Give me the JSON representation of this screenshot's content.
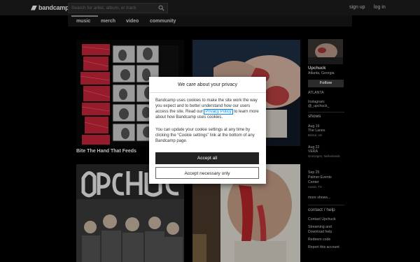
{
  "header": {
    "logo_text": "bandcamp",
    "search_placeholder": "Search for artist, album, or track",
    "signup": "sign up",
    "login": "log in"
  },
  "tabs": [
    "music",
    "merch",
    "video",
    "community"
  ],
  "albums": [
    {
      "title": "Bite The Hand That Feeds"
    },
    {
      "title": ""
    },
    {
      "title": ""
    },
    {
      "title": ""
    }
  ],
  "artist": {
    "name": "Upchuck",
    "location": "Atlanta, Georgia",
    "follow": "Follow",
    "city_tag": "ATLANTA",
    "instagram_label": "Instagram:",
    "instagram_handle": "@_upchuck_"
  },
  "shows": {
    "heading": "shows",
    "items": [
      {
        "date": "Aug 19",
        "venue": "The Lanes",
        "place": "Bristol, UK"
      },
      {
        "date": "Aug 22",
        "venue": "VERA",
        "place": "Groningen, Netherlands"
      },
      {
        "date": "Sep 25",
        "venue": "Palmer Events Center",
        "place": "Austin, TX"
      }
    ],
    "more": "more shows..."
  },
  "contact": {
    "heading": "contact / help",
    "links": [
      "Contact Upchuck",
      "Streaming and Download help",
      "Redeem code",
      "Report this account"
    ]
  },
  "cookie_modal": {
    "title": "We care about your privacy",
    "p1_before": "Bandcamp uses cookies to make the site work the way you expect and to better understand how our users access the site. Read our",
    "p1_link": "Privacy Policy",
    "p1_after": "to learn more about how Bandcamp uses cookies.",
    "p2": "You can update your cookie settings at any time by clicking the “Cookie settings” link at the bottom of any Bandcamp page.",
    "accept_all": "Accept all",
    "accept_necessary": "Accept necessary only"
  }
}
